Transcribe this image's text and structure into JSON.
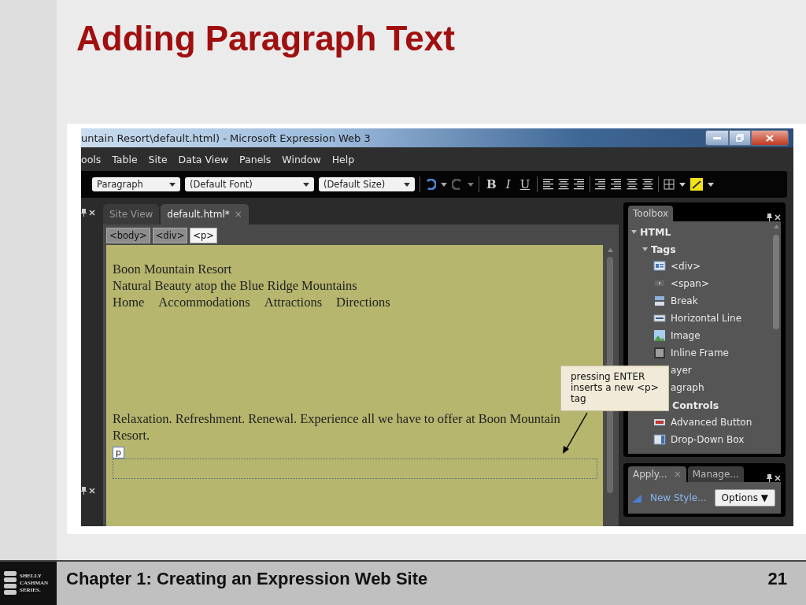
{
  "slide": {
    "title": "Adding Paragraph Text"
  },
  "window": {
    "title": "untain Resort\\default.html) - Microsoft Expression Web 3"
  },
  "menu": [
    "ools",
    "Table",
    "Site",
    "Data View",
    "Panels",
    "Window",
    "Help"
  ],
  "toolbar": {
    "dropdowns": [
      {
        "value": "Paragraph"
      },
      {
        "value": "(Default Font)"
      },
      {
        "value": "(Default Size)"
      }
    ],
    "format_buttons": [
      {
        "label": "B",
        "kind": "bold"
      },
      {
        "label": "I",
        "kind": "italic"
      },
      {
        "label": "U",
        "kind": "underline"
      }
    ]
  },
  "editor": {
    "tabs": [
      {
        "label": "Site View",
        "selected": false
      },
      {
        "label": "default.html*",
        "selected": true,
        "close": "×"
      }
    ],
    "breadcrumb": [
      {
        "label": "<body>",
        "selected": false
      },
      {
        "label": "<div>",
        "selected": false
      },
      {
        "label": "<p>",
        "selected": true
      }
    ],
    "lines": [
      "Boon Mountain Resort",
      "Natural Beauty atop the Blue Ridge Mountains"
    ],
    "nav": [
      "Home",
      "Accommodations",
      "Attractions",
      "Directions"
    ],
    "paragraph": "Relaxation. Refreshment. Renewal. Experience all we have to offer at Boon Mountain Resort.",
    "new_tag": "p",
    "callout": "pressing ENTER inserts a new <p> tag"
  },
  "toolbox": {
    "title": "Toolbox",
    "tree": [
      {
        "label": "HTML",
        "expanded": true,
        "children": [
          {
            "label": "Tags",
            "expanded": true,
            "children": [
              {
                "label": "<div>",
                "kind": "div"
              },
              {
                "label": "<span>",
                "kind": "span"
              },
              {
                "label": "Break",
                "kind": "break"
              },
              {
                "label": "Horizontal Line",
                "kind": "hr"
              },
              {
                "label": "Image",
                "kind": "image"
              },
              {
                "label": "Inline Frame",
                "kind": "iframe"
              },
              {
                "label": "ayer"
              },
              {
                "label": "agraph"
              }
            ]
          },
          {
            "label": "Controls",
            "children": [
              {
                "label": "Advanced Button",
                "kind": "button"
              },
              {
                "label": "Drop-Down Box",
                "kind": "dropdown"
              }
            ]
          }
        ]
      }
    ]
  },
  "styles_panel": {
    "tabs": [
      {
        "label": "Apply...",
        "selected": true,
        "close": "×"
      },
      {
        "label": "Manage...",
        "selected": false
      }
    ],
    "new_style": "New Style...",
    "options": "Options ▼"
  },
  "footer": {
    "logo": [
      "SHELLY",
      "CASHMAN",
      "SERIES."
    ],
    "chapter": "Chapter 1: Creating an Expression Web Site",
    "page": "21"
  }
}
